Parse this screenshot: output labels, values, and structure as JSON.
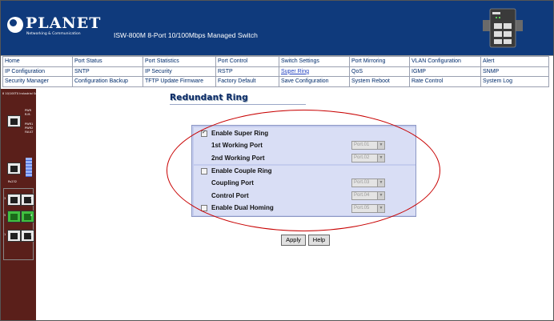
{
  "header": {
    "logo_text": "PLANET",
    "logo_tagline": "Networking & Communication",
    "title": "ISW-800M 8-Port 10/100Mbps Managed Switch"
  },
  "nav": {
    "rows": [
      [
        "Home",
        "Port Status",
        "Port Statistics",
        "Port Control",
        "Switch Settings",
        "Port Mirroring",
        "VLAN Configuration",
        "Alert"
      ],
      [
        "IP Configuration",
        "SNTP",
        "IP Security",
        "RSTP",
        "Super Ring",
        "QoS",
        "IGMP",
        "SNMP"
      ],
      [
        "Security Manager",
        "Configuration Backup",
        "TFTP Update Firmware",
        "Factory Default",
        "Save Configuration",
        "System Reboot",
        "Rate Control",
        "System Log"
      ]
    ],
    "active": "Super Ring"
  },
  "left_panel": {
    "device_label": "8 10/100TX Industrial Switch",
    "led_labels": [
      "PWR",
      "R.M.",
      "PWR1",
      "PWR2",
      "FAULT"
    ],
    "rs232_label": "Rs232",
    "port_numbers": [
      "3",
      "4",
      "5",
      "6",
      "1",
      "2"
    ]
  },
  "page": {
    "title": "Redundant Ring"
  },
  "form": {
    "enable_super_ring": {
      "label": "Enable Super Ring",
      "checked": true
    },
    "first_working_port": {
      "label": "1st Working Port",
      "value": "Port.01"
    },
    "second_working_port": {
      "label": "2nd Working Port",
      "value": "Port.02"
    },
    "enable_couple_ring": {
      "label": "Enable Couple Ring",
      "checked": false
    },
    "coupling_port": {
      "label": "Coupling Port",
      "value": "Port.03"
    },
    "control_port": {
      "label": "Control Port",
      "value": "Port.04"
    },
    "enable_dual_homing": {
      "label": "Enable Dual Homing",
      "checked": false,
      "value": "Port.05"
    }
  },
  "buttons": {
    "apply": "Apply",
    "help": "Help"
  },
  "colors": {
    "header_bg": "#0f3a7c",
    "nav_text": "#002b6b",
    "left_panel_bg": "#5a1f1a",
    "form_panel": "#c4ccee",
    "annotation": "#c80000"
  }
}
